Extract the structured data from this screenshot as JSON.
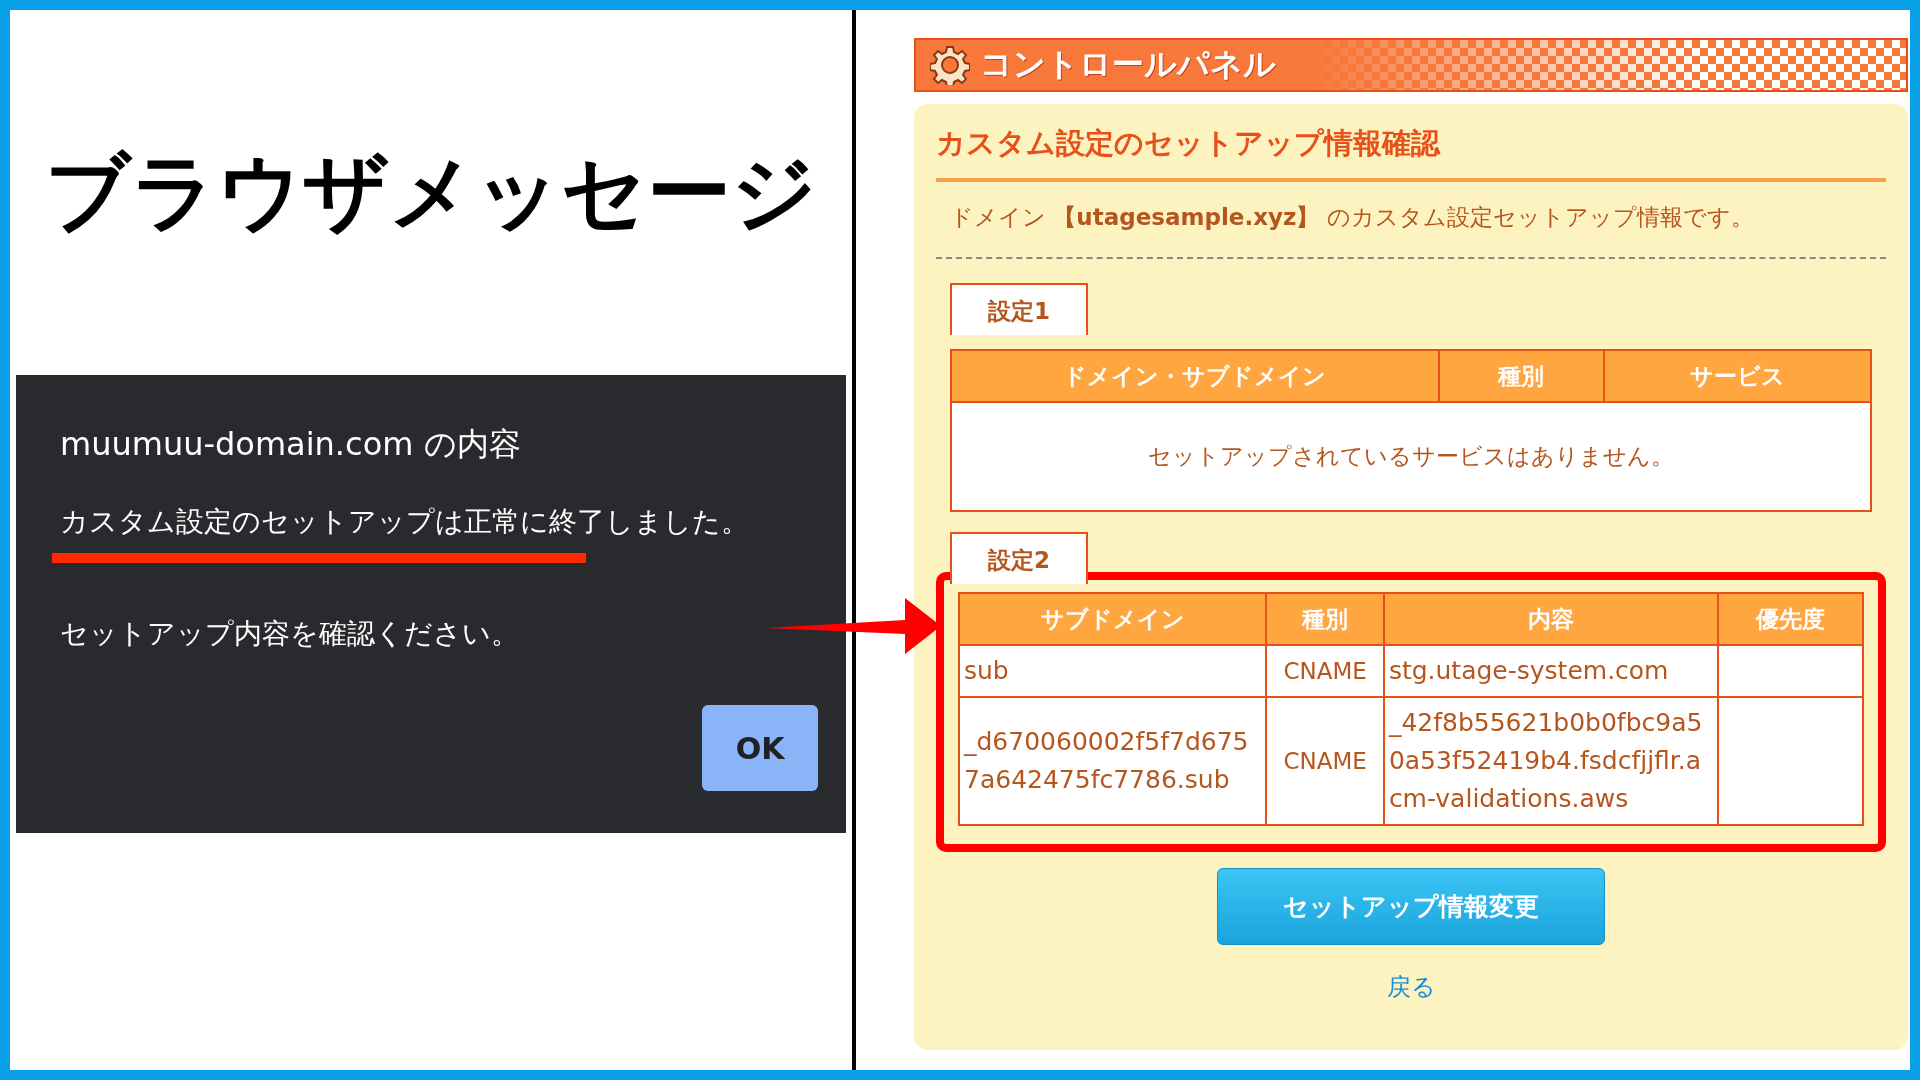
{
  "heading": "ブラウザメッセージ",
  "dialog": {
    "title": "muumuu-domain.com の内容",
    "message": "カスタム設定のセットアップは正常に終了しました。",
    "message_highlighted": true,
    "message_2": "セットアップ内容を確認ください。",
    "ok_button": "OK"
  },
  "control_panel": {
    "title": "コントロールパネル",
    "section_title": "カスタム設定のセットアップ情報確認",
    "description": "ドメイン **【utagesample.xyz】** のカスタム設定セットアップ情報です。",
    "settings": [
      {
        "label": "設定1",
        "highlighted": false,
        "columns": [
          "ドメイン・サブドメイン",
          "種別",
          "サービス"
        ],
        "empty_message": "セットアップされているサービスはありません。"
      },
      {
        "label": "設定2",
        "highlighted": true,
        "columns": [
          "サブドメイン",
          "種別",
          "内容",
          "優先度"
        ],
        "rows": [
          [
            "sub",
            "CNAME",
            "stg.utage-system.com",
            ""
          ],
          [
            "_d670060002f5f7d6757a642475fc7786.sub",
            "CNAME",
            "_42f8b55621b0b0fbc9a50a53f52419b4.fsdcfjjflr.acm-validations.aws",
            ""
          ]
        ]
      }
    ],
    "primary_button": "セットアップ情報変更",
    "back_link": "戻る"
  }
}
